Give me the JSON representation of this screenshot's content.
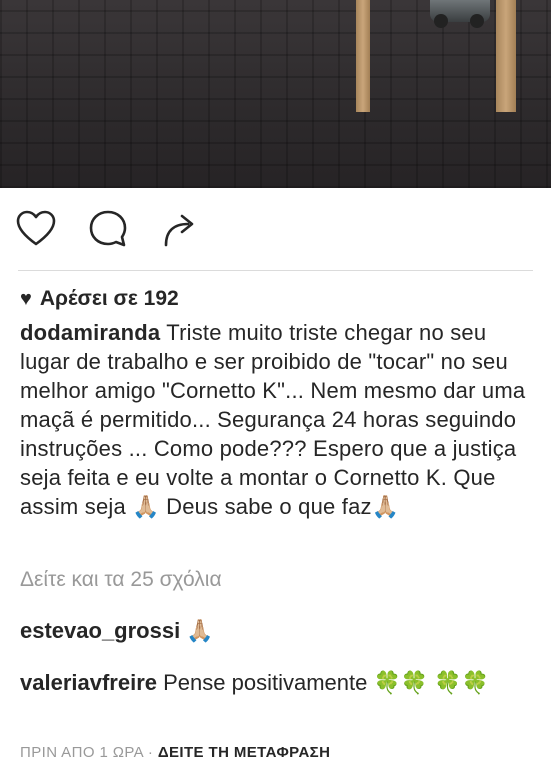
{
  "post": {
    "likes": {
      "heart_icon": "heart-filled-icon",
      "text": "Αρέσει σε 192"
    },
    "caption": {
      "username": "dodamiranda",
      "text": "Triste muito triste chegar no seu lugar de trabalho e ser proibido de \"tocar\" no seu melhor amigo \"Cornetto K\"... Nem mesmo dar uma maçã é permitido... Segurança 24 horas seguindo instruções ... Como pode??? Espero que a justiça seja feita e eu volte a montar o Cornetto K. Que assim seja 🙏🏼 Deus sabe o que faz🙏🏼"
    },
    "view_all_comments": "Δείτε και τα 25 σχόλια",
    "comments": [
      {
        "username": "estevao_grossi",
        "text": "🙏🏼"
      },
      {
        "username": "valeriavfreire",
        "text": "Pense positivamente 🍀🍀 🍀🍀"
      }
    ],
    "timestamp": "ΠΡΙΝ ΑΠΟ 1 ΩΡΑ",
    "separator": "·",
    "translate": "ΔΕΙΤΕ ΤΗ ΜΕΤΑΦΡΑΣΗ"
  },
  "icons": {
    "like": "heart-outline-icon",
    "comment": "comment-bubble-icon",
    "share": "share-arrow-icon"
  }
}
